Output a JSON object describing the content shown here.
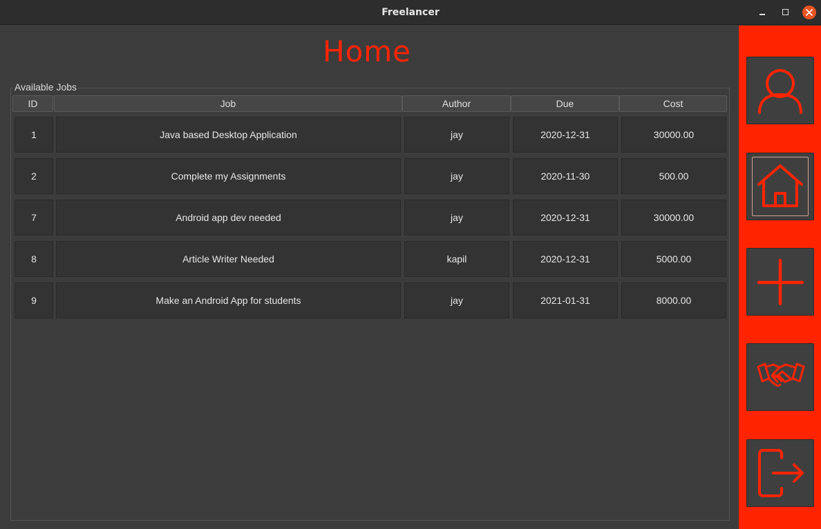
{
  "window": {
    "title": "Freelancer"
  },
  "page": {
    "heading": "Home",
    "accent_color": "#ff2400"
  },
  "jobs": {
    "group_label": "Available Jobs",
    "columns": [
      "ID",
      "Job",
      "Author",
      "Due",
      "Cost"
    ],
    "rows": [
      [
        "1",
        "Java based Desktop Application",
        "jay",
        "2020-12-31",
        "30000.00"
      ],
      [
        "2",
        "Complete my Assignments",
        "jay",
        "2020-11-30",
        "500.00"
      ],
      [
        "7",
        "Android app dev needed",
        "jay",
        "2020-12-31",
        "30000.00"
      ],
      [
        "8",
        "Article Writer Needed",
        "kapil",
        "2020-12-31",
        "5000.00"
      ],
      [
        "9",
        "Make an Android App for students",
        "jay",
        "2021-01-31",
        "8000.00"
      ]
    ]
  },
  "sidebar": {
    "items": [
      {
        "icon": "user-icon",
        "active": false
      },
      {
        "icon": "home-icon",
        "active": true
      },
      {
        "icon": "plus-icon",
        "active": false
      },
      {
        "icon": "handshake-icon",
        "active": false
      },
      {
        "icon": "logout-icon",
        "active": false
      }
    ]
  }
}
